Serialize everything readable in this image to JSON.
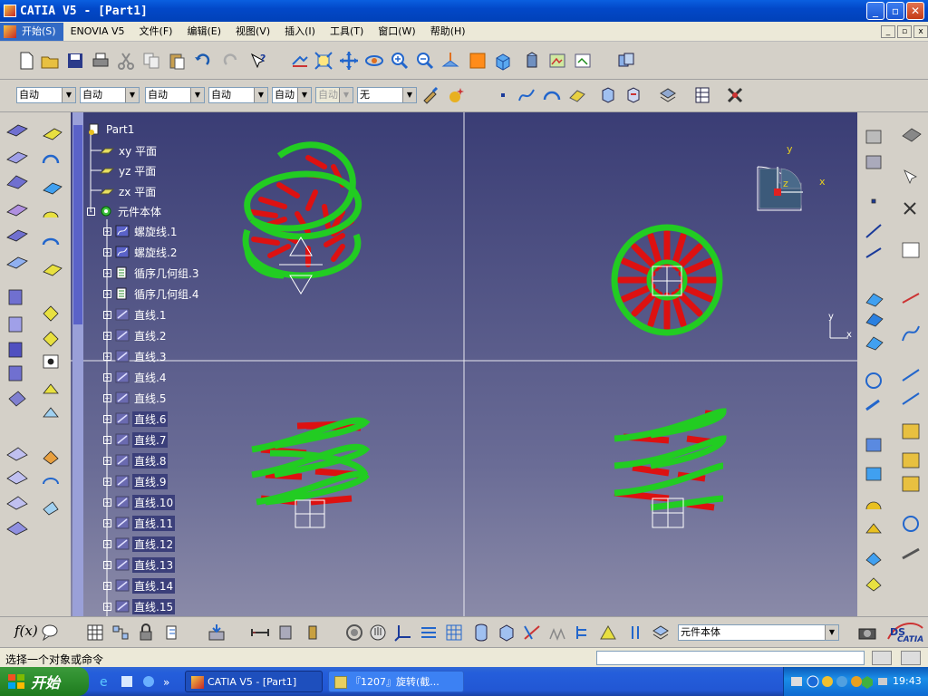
{
  "window": {
    "title": "CATIA V5 - [Part1]"
  },
  "menu": [
    "开始(S)",
    "ENOVIA V5",
    "文件(F)",
    "编辑(E)",
    "视图(V)",
    "插入(I)",
    "工具(T)",
    "窗口(W)",
    "帮助(H)"
  ],
  "toolbar2": {
    "selects": [
      "自动",
      "自动",
      "自动",
      "自动",
      "自动",
      "自动",
      "无"
    ]
  },
  "tree": {
    "root": "Part1",
    "planes": [
      "xy 平面",
      "yz 平面",
      "zx 平面"
    ],
    "body": "元件本体",
    "items": [
      "螺旋线.1",
      "螺旋线.2",
      "循序几何组.3",
      "循序几何组.4",
      "直线.1",
      "直线.2",
      "直线.3",
      "直线.4",
      "直线.5",
      "直线.6",
      "直线.7",
      "直线.8",
      "直线.9",
      "直线.10",
      "直线.11",
      "直线.12",
      "直线.13",
      "直线.14",
      "直线.15"
    ]
  },
  "compass": {
    "y": "y",
    "x": "x",
    "z": "z"
  },
  "axis_mini": {
    "y": "y",
    "x": "x"
  },
  "bottom": {
    "current_body": "元件本体",
    "logo": "CATIA"
  },
  "status": {
    "message": "选择一个对象或命令"
  },
  "taskbar": {
    "start": "开始",
    "tasks": [
      "CATIA V5 - [Part1]",
      "『1207』旋转(截..."
    ],
    "time": "19:43"
  },
  "colors": {
    "helix": "#22cc22",
    "rungs": "#dd1111",
    "viewport_top": "#3a3d75",
    "title_blue": "#0a5fe0"
  }
}
